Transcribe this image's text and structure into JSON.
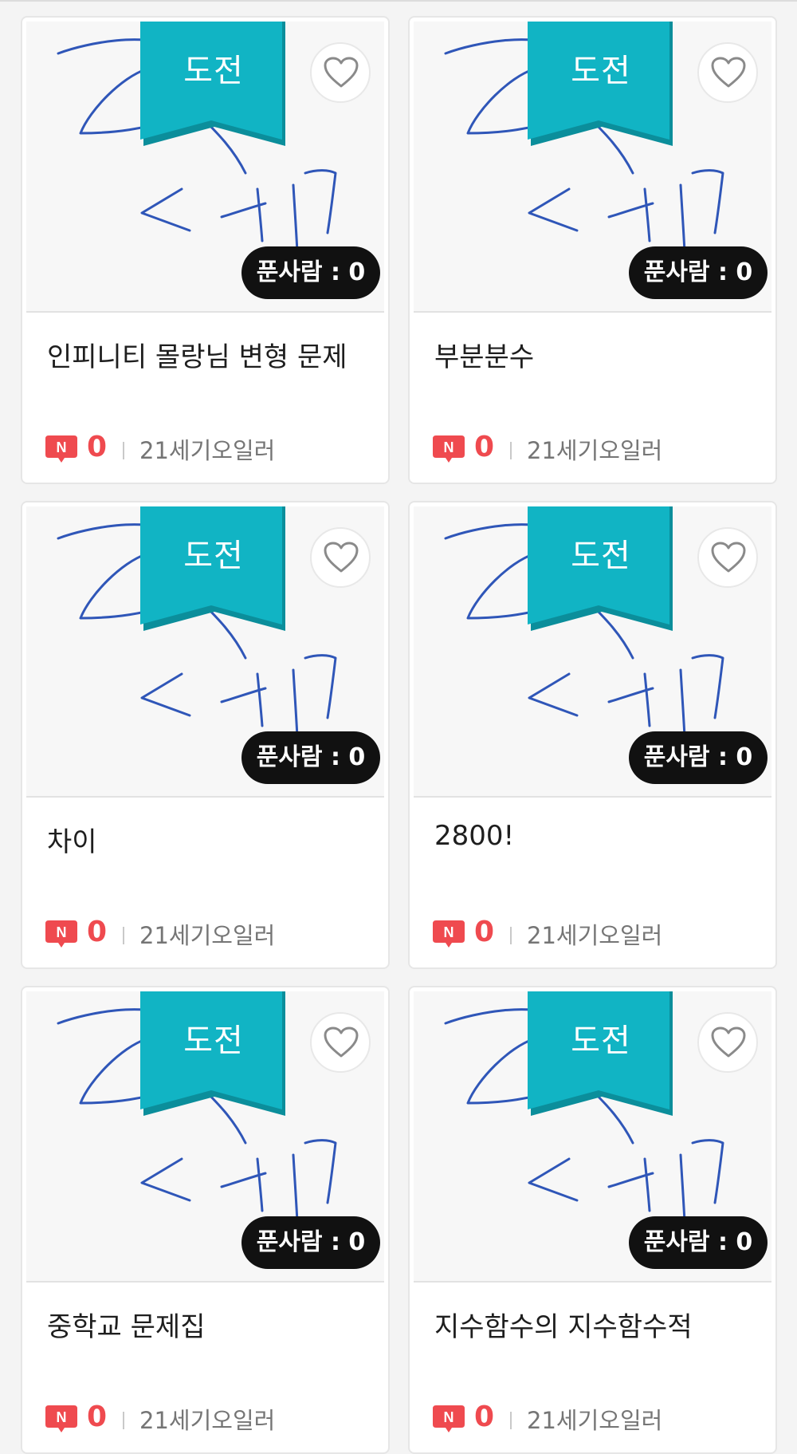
{
  "colors": {
    "ribbon": "#11b4c4",
    "ribbon_shadow": "#0b8e9b",
    "badge_red": "#ef4a4f",
    "sketch_ink": "#2f56b8",
    "solver_pill": "#111111"
  },
  "icons": {
    "favorite": "heart-outline-icon",
    "new_badge": "new-comment-badge-icon",
    "thumbnail": "handwriting-sketch-thumbnail"
  },
  "cards": [
    {
      "ribbon": "도전",
      "solvers": "푼사람 : 0",
      "title": "인피니티 몰랑님 변형 문제",
      "new_badge": "N",
      "comments": "0",
      "author": "21세기오일러"
    },
    {
      "ribbon": "도전",
      "solvers": "푼사람 : 0",
      "title": "부분분수",
      "new_badge": "N",
      "comments": "0",
      "author": "21세기오일러"
    },
    {
      "ribbon": "도전",
      "solvers": "푼사람 : 0",
      "title": "차이",
      "new_badge": "N",
      "comments": "0",
      "author": "21세기오일러"
    },
    {
      "ribbon": "도전",
      "solvers": "푼사람 : 0",
      "title": "2800!",
      "new_badge": "N",
      "comments": "0",
      "author": "21세기오일러"
    },
    {
      "ribbon": "도전",
      "solvers": "푼사람 : 0",
      "title": "중학교 문제집",
      "new_badge": "N",
      "comments": "0",
      "author": "21세기오일러"
    },
    {
      "ribbon": "도전",
      "solvers": "푼사람 : 0",
      "title": "지수함수의 지수함수적",
      "new_badge": "N",
      "comments": "0",
      "author": "21세기오일러"
    }
  ]
}
